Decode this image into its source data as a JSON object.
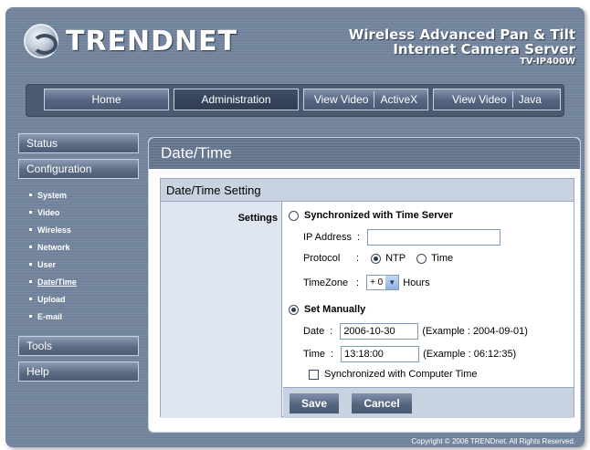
{
  "header": {
    "brand": "TRENDNET",
    "product_line1": "Wireless Advanced Pan & Tilt",
    "product_line2": "Internet Camera Server",
    "model": "TV-IP400W"
  },
  "nav": {
    "home": "Home",
    "administration": "Administration",
    "view_video_1": "View Video",
    "activex": "ActiveX",
    "view_video_2": "View Video",
    "java": "Java"
  },
  "sidebar": {
    "status": "Status",
    "configuration": "Configuration",
    "items": [
      {
        "label": "System"
      },
      {
        "label": "Video"
      },
      {
        "label": "Wireless"
      },
      {
        "label": "Network"
      },
      {
        "label": "User"
      },
      {
        "label": "Date/Time"
      },
      {
        "label": "Upload"
      },
      {
        "label": "E-mail"
      }
    ],
    "tools": "Tools",
    "help": "Help"
  },
  "page": {
    "title": "Date/Time",
    "section_title": "Date/Time Setting",
    "settings_label": "Settings"
  },
  "sync_server": {
    "label": "Synchronized with Time Server",
    "selected": false,
    "ip_label": "IP Address",
    "ip_sep": ":",
    "ip_value": "",
    "protocol_label": "Protocol",
    "protocol_sep": ":",
    "protocol_ntp": "NTP",
    "protocol_time": "Time",
    "protocol_selected": "NTP",
    "timezone_label": "TimeZone",
    "timezone_sep": ":",
    "timezone_value": "+ 0",
    "timezone_unit": "Hours"
  },
  "manual": {
    "label": "Set Manually",
    "selected": true,
    "date_label": "Date",
    "date_sep": ":",
    "date_value": "2006-10-30",
    "date_example": "(Example : 2004-09-01)",
    "time_label": "Time",
    "time_sep": ":",
    "time_value": "13:18:00",
    "time_example": "(Example : 06:12:35)",
    "sync_computer_label": "Synchronized with Computer Time",
    "sync_computer_checked": false
  },
  "buttons": {
    "save": "Save",
    "cancel": "Cancel"
  },
  "footer": {
    "copyright": "Copyright © 2006 TRENDnet. All Rights Reserved."
  },
  "colors": {
    "frame": "#6d7e96",
    "nav_active": "#2f3c52",
    "settings_header": "#c8d2e0"
  }
}
